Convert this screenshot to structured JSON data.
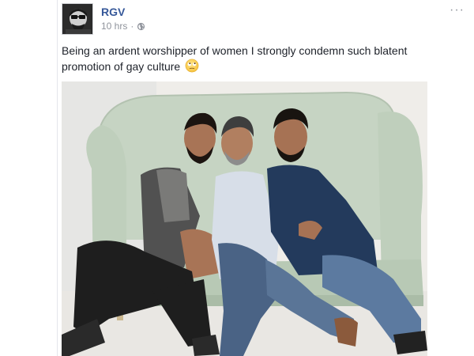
{
  "post": {
    "author": "RGV",
    "time": "10 hrs",
    "separator": "·",
    "text": "Being an ardent worshipper of women I strongly condemn such blatent promotion of gay culture",
    "emoji": "rolling-eyes-emoji",
    "privacy_icon": "globe-icon",
    "more_icon": "ellipsis-icon",
    "more_glyph": "···"
  },
  "photo": {
    "subject": "three-men-on-sofa"
  },
  "colors": {
    "author_link": "#365899",
    "meta_text": "#90949c",
    "body_text": "#1d2129",
    "sofa": "#c6d4c3"
  }
}
